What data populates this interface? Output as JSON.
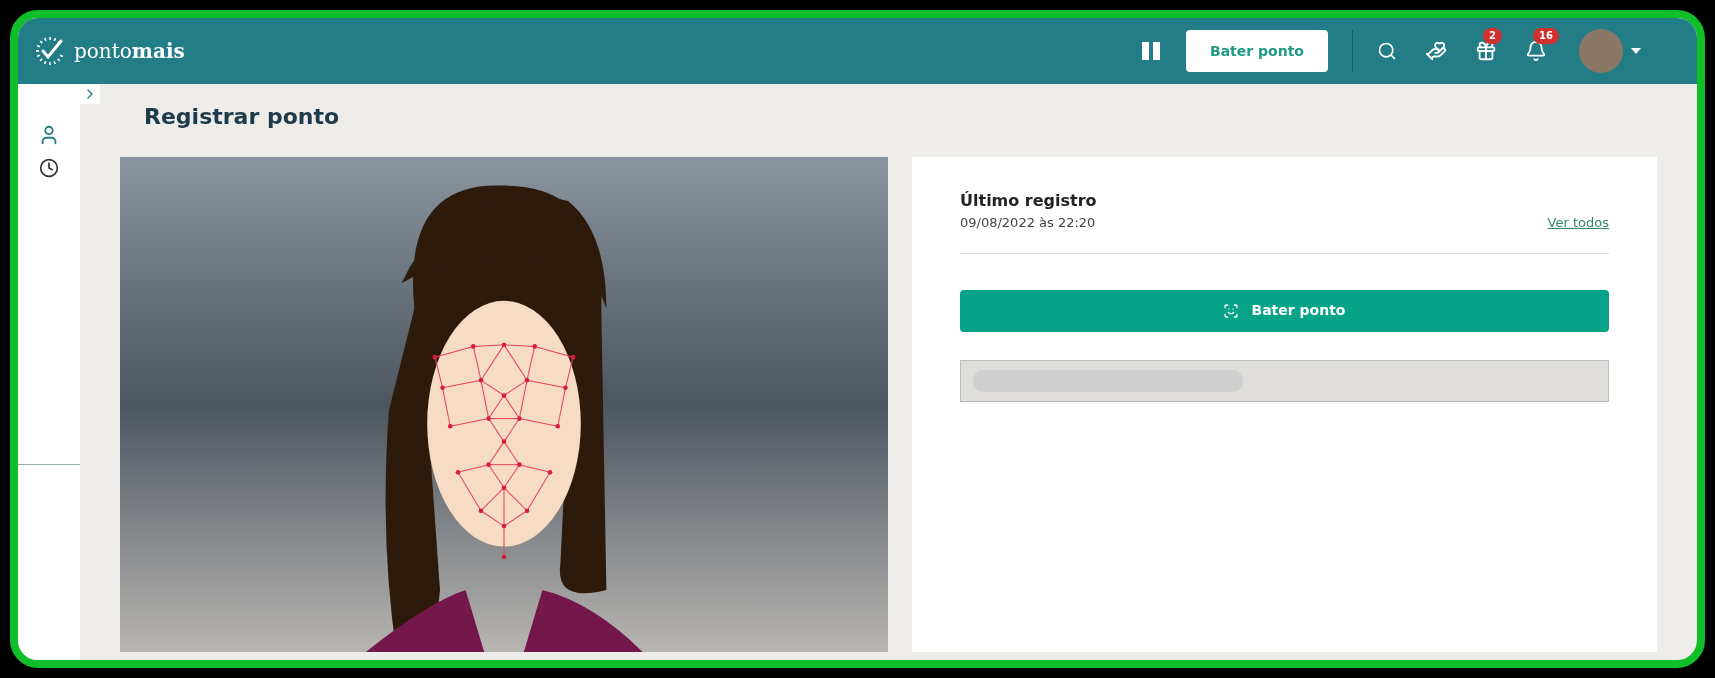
{
  "header": {
    "brand_prefix": "ponto",
    "brand_suffix": "mais",
    "punch_button": "Bater ponto",
    "badges": [
      {
        "kind": "gift",
        "count": "2"
      },
      {
        "kind": "bell",
        "count": "16"
      }
    ]
  },
  "sidebar": {
    "collapsed": true
  },
  "page_title": "Registrar ponto",
  "card": {
    "title": "Último registro",
    "timestamp": "09/08/2022 às 22:20",
    "see_all": "Ver todos",
    "punch_button": "Bater ponto",
    "loading": true
  }
}
